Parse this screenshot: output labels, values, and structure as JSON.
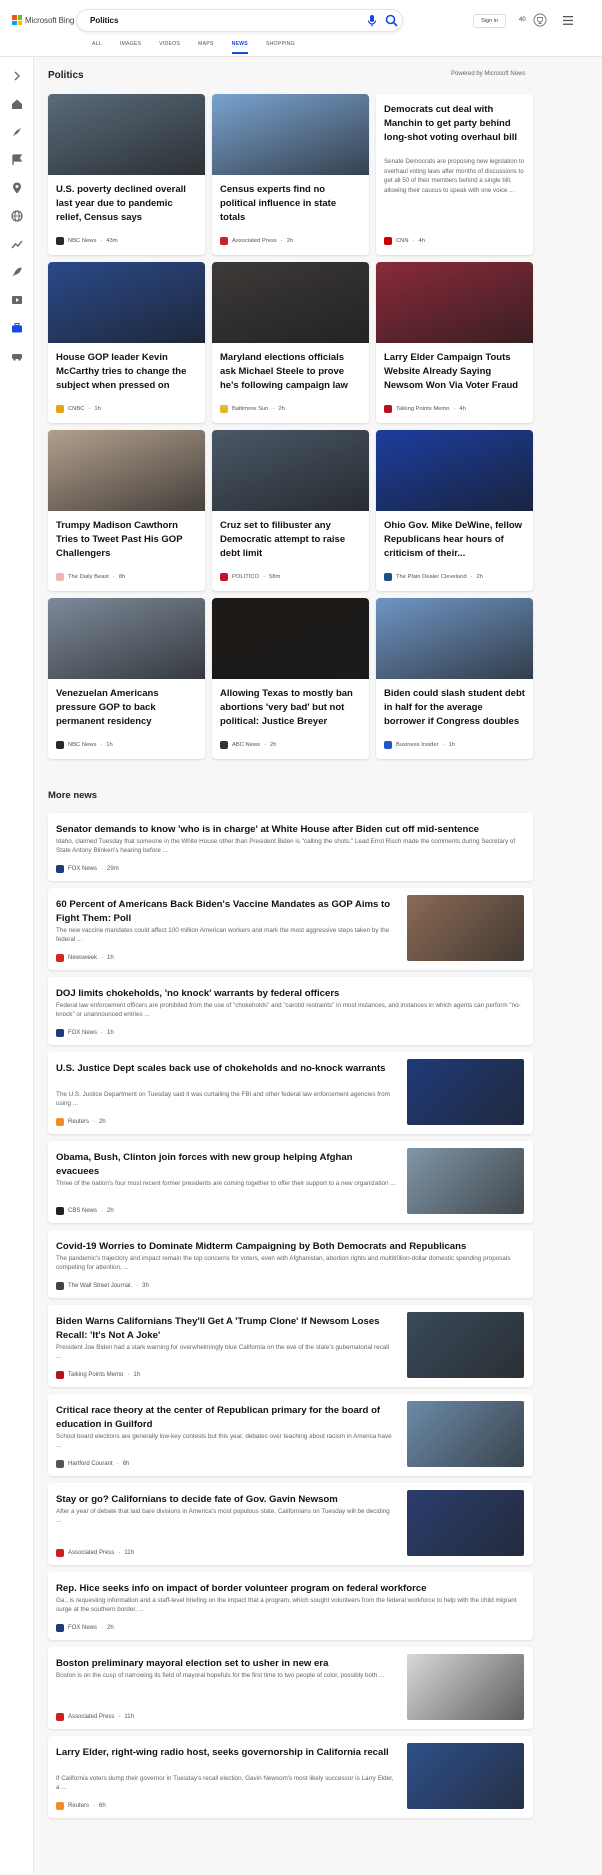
{
  "header": {
    "brand": "Microsoft Bing",
    "search_value": "Politics",
    "signin_label": "Sign in",
    "points": "40",
    "tabs": [
      "ALL",
      "IMAGES",
      "VIDEOS",
      "MAPS",
      "NEWS",
      "SHOPPING"
    ],
    "active_tab": "NEWS"
  },
  "rail": {
    "icons": [
      "collapse-icon",
      "home-icon",
      "discover-icon",
      "flag-icon",
      "location-icon",
      "globe-icon",
      "chart-icon",
      "rocket-icon",
      "video-icon",
      "briefcase-icon",
      "car-icon"
    ]
  },
  "section": {
    "title": "Politics",
    "powered_by": "Powered by Microsoft News"
  },
  "cards": [
    {
      "title": "U.S. poverty declined overall last year due to pandemic relief, Census says",
      "source": "NBC News",
      "time": "43m",
      "img_color": "#5a6b7a",
      "logo_color": "#2a2a2a"
    },
    {
      "title": "Census experts find no political influence in state totals",
      "source": "Associated Press",
      "time": "2h",
      "img_color": "#7aa3d0",
      "logo_color": "#cc1f1f"
    },
    {
      "title": "Democrats cut deal with Manchin to get party behind long-shot voting overhaul bill",
      "snippet": "Senate Democrats are proposing new legislation to overhaul voting laws after months of discussions to get all 50 of their members behind a single bill, allowing their caucus to speak with one voice ...",
      "source": "CNN",
      "time": "4h",
      "logo_color": "#cc0000"
    },
    {
      "title": "House GOP leader Kevin McCarthy tries to change the subject when pressed on Covi...",
      "source": "CNBC",
      "time": "1h",
      "img_color": "#2a4a8a",
      "logo_color": "#e8a317"
    },
    {
      "title": "Maryland elections officials ask Michael Steele to prove he's following campaign law",
      "source": "Baltimore Sun",
      "time": "2h",
      "img_color": "#3d3a38",
      "logo_color": "#e8b62e"
    },
    {
      "title": "Larry Elder Campaign Touts Website Already Saying Newsom Won Via Voter Fraud",
      "source": "Talking Points Memo",
      "time": "4h",
      "img_color": "#8a2a3a",
      "logo_color": "#b5121b"
    },
    {
      "title": "Trumpy Madison Cawthorn Tries to Tweet Past His GOP Challengers",
      "source": "The Daily Beast",
      "time": "8h",
      "img_color": "#b2a08e",
      "logo_color": "#f0b5b5"
    },
    {
      "title": "Cruz set to filibuster any Democratic attempt to raise debt limit",
      "source": "POLITICO",
      "time": "58m",
      "img_color": "#4a5868",
      "logo_color": "#c8102e"
    },
    {
      "title": "Ohio Gov. Mike DeWine, fellow Republicans hear hours of criticism of their...",
      "source": "The Plain Dealer Cleveland",
      "time": "2h",
      "img_color": "#1b3d9e",
      "logo_color": "#1c4f8a"
    },
    {
      "title": "Venezuelan Americans pressure GOP to back permanent residency",
      "source": "NBC News",
      "time": "1h",
      "img_color": "#7d8a9a",
      "logo_color": "#2a2a2a"
    },
    {
      "title": "Allowing Texas to mostly ban abortions 'very bad' but not political: Justice Breyer",
      "source": "ABC News",
      "time": "2h",
      "img_color": "#1e1a18",
      "logo_color": "#333333"
    },
    {
      "title": "Biden could slash student debt in half for the average borrower if Congress doubles the Pell...",
      "source": "Business Insider",
      "time": "1h",
      "img_color": "#6f95c4",
      "logo_color": "#2155c8"
    }
  ],
  "more_news": {
    "title": "More news",
    "items": [
      {
        "title": "Senator demands to know 'who is in charge' at White House after Biden cut off mid-sentence",
        "snippet": "Idaho, claimed Tuesday that someone in the White House other than President Biden is \"calling the shots.\" Lead Errol Risch made the comments during Secretary of State Antony Blinken's hearing before ...",
        "source": "FOX News",
        "time": "29m",
        "logo_color": "#1d3b7a"
      },
      {
        "title": "60 Percent of Americans Back Biden's Vaccine Mandates as GOP Aims to Fight Them: Poll",
        "snippet": "The new vaccine mandates could affect 100 million American workers and mark the most aggressive steps taken by the federal ...",
        "source": "Newsweek",
        "time": "1h",
        "logo_color": "#d6231e",
        "thumb_color": "#8a6a55"
      },
      {
        "title": "DOJ limits chokeholds, 'no knock' warrants by federal officers",
        "snippet": "Federal law enforcement officers are prohibited from the use of \"chokeholds\" and \"carotid restraints\" in most instances, and instances in which agents can perform \"no-knock\" or unannounced entries ...",
        "source": "FOX News",
        "time": "1h",
        "logo_color": "#1d3b7a"
      },
      {
        "title": "U.S. Justice Dept scales back use of chokeholds and no-knock warrants",
        "snippet": "The U.S. Justice Department on Tuesday said it was curtailing the FBI and other federal law enforcement agencies from using ...",
        "source": "Reuters",
        "time": "2h",
        "logo_color": "#f28c28",
        "thumb_color": "#1f3a78"
      },
      {
        "title": "Obama, Bush, Clinton join forces with new group helping Afghan evacuees",
        "snippet": "Three of the nation's four most recent former presidents are coming together to offer their support to a new organization ...",
        "source": "CBS News",
        "time": "2h",
        "logo_color": "#222222",
        "thumb_color": "#8096a8"
      },
      {
        "title": "Covid-19 Worries to Dominate Midterm Campaigning by Both Democrats and Republicans",
        "snippet": "The pandemic's trajectory and impact remain the top concerns for voters, even with Afghanistan, abortion rights and multitrillion-dollar domestic spending proposals competing for attention, ...",
        "source": "The Wall Street Journal.",
        "time": "3h",
        "logo_color": "#444444"
      },
      {
        "title": "Biden Warns Californians They'll Get A 'Trump Clone' If Newsom Loses Recall: 'It's Not A Joke'",
        "snippet": "President Joe Biden had a stark warning for overwhelmingly blue California on the eve of the state's gubernatorial recall ...",
        "source": "Talking Points Memo",
        "time": "1h",
        "logo_color": "#b5121b",
        "thumb_color": "#3a4a5a"
      },
      {
        "title": "Critical race theory at the center of Republican primary for the board of education in Guilford",
        "snippet": "School board elections are generally low-key contests but this year, debates over teaching about racism in America have ...",
        "source": "Hartford Courant",
        "time": "6h",
        "logo_color": "#555555",
        "thumb_color": "#6b8aa8"
      },
      {
        "title": "Stay or go? Californians to decide fate of Gov. Gavin Newsom",
        "snippet": "After a year of debate that laid bare divisions in America's most populous state, Californians on Tuesday will be deciding ...",
        "source": "Associated Press",
        "time": "11h",
        "logo_color": "#cc1f1f",
        "thumb_color": "#2a3d6e"
      },
      {
        "title": "Rep. Hice seeks info on impact of border volunteer program on federal workforce",
        "snippet": "Ga., is requesting information and a staff-level briefing on the impact that a program, which sought volunteers from the federal workforce to help with the child migrant surge at the southern border, ...",
        "source": "FOX News",
        "time": "2h",
        "logo_color": "#1d3b7a"
      },
      {
        "title": "Boston preliminary mayoral election set to usher in new era",
        "snippet": "Boston is on the cusp of narrowing its field of mayoral hopefuls for the first time to two people of color, possibly both ...",
        "source": "Associated Press",
        "time": "11h",
        "logo_color": "#cc1f1f",
        "thumb_color": "#d8d8d8"
      },
      {
        "title": "Larry Elder, right-wing radio host, seeks governorship in California recall",
        "snippet": "If California voters dump their governor in Tuesday's recall election, Gavin Newsom's most likely successor is Larry Elder, a ...",
        "source": "Reuters",
        "time": "6h",
        "logo_color": "#f28c28",
        "thumb_color": "#2d4f8a"
      }
    ]
  },
  "colors": {
    "accent": "#174ae4",
    "brand_red": "#f25022",
    "brand_green": "#7fba00",
    "brand_blue": "#00a4ef",
    "brand_yellow": "#ffb900"
  }
}
